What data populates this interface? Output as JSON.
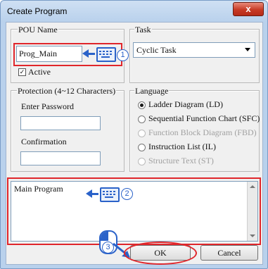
{
  "window": {
    "title": "Create Program",
    "close_glyph": "x"
  },
  "pou": {
    "legend": "POU Name",
    "value": "Prog_Main",
    "active_label": "Active",
    "active_checked": true
  },
  "task": {
    "legend": "Task",
    "selected": "Cyclic Task"
  },
  "protection": {
    "legend": "Protection (4~12 Characters)",
    "password_label": "Enter Password",
    "password_value": "",
    "confirm_label": "Confirmation",
    "confirm_value": ""
  },
  "language": {
    "legend": "Language",
    "options": [
      {
        "label": "Ladder Diagram (LD)",
        "selected": true,
        "enabled": true
      },
      {
        "label": "Sequential Function Chart (SFC)",
        "selected": false,
        "enabled": true
      },
      {
        "label": "Function Block Diagram (FBD)",
        "selected": false,
        "enabled": false
      },
      {
        "label": "Instruction List (IL)",
        "selected": false,
        "enabled": true
      },
      {
        "label": "Structure Text (ST)",
        "selected": false,
        "enabled": false
      }
    ]
  },
  "comment": {
    "value": "Main Program"
  },
  "buttons": {
    "ok": "OK",
    "cancel": "Cancel"
  },
  "annotations": {
    "step1": "1",
    "step2": "2",
    "step3": "3",
    "highlight_color": "#e0262b",
    "annotation_color": "#2a62c9"
  }
}
